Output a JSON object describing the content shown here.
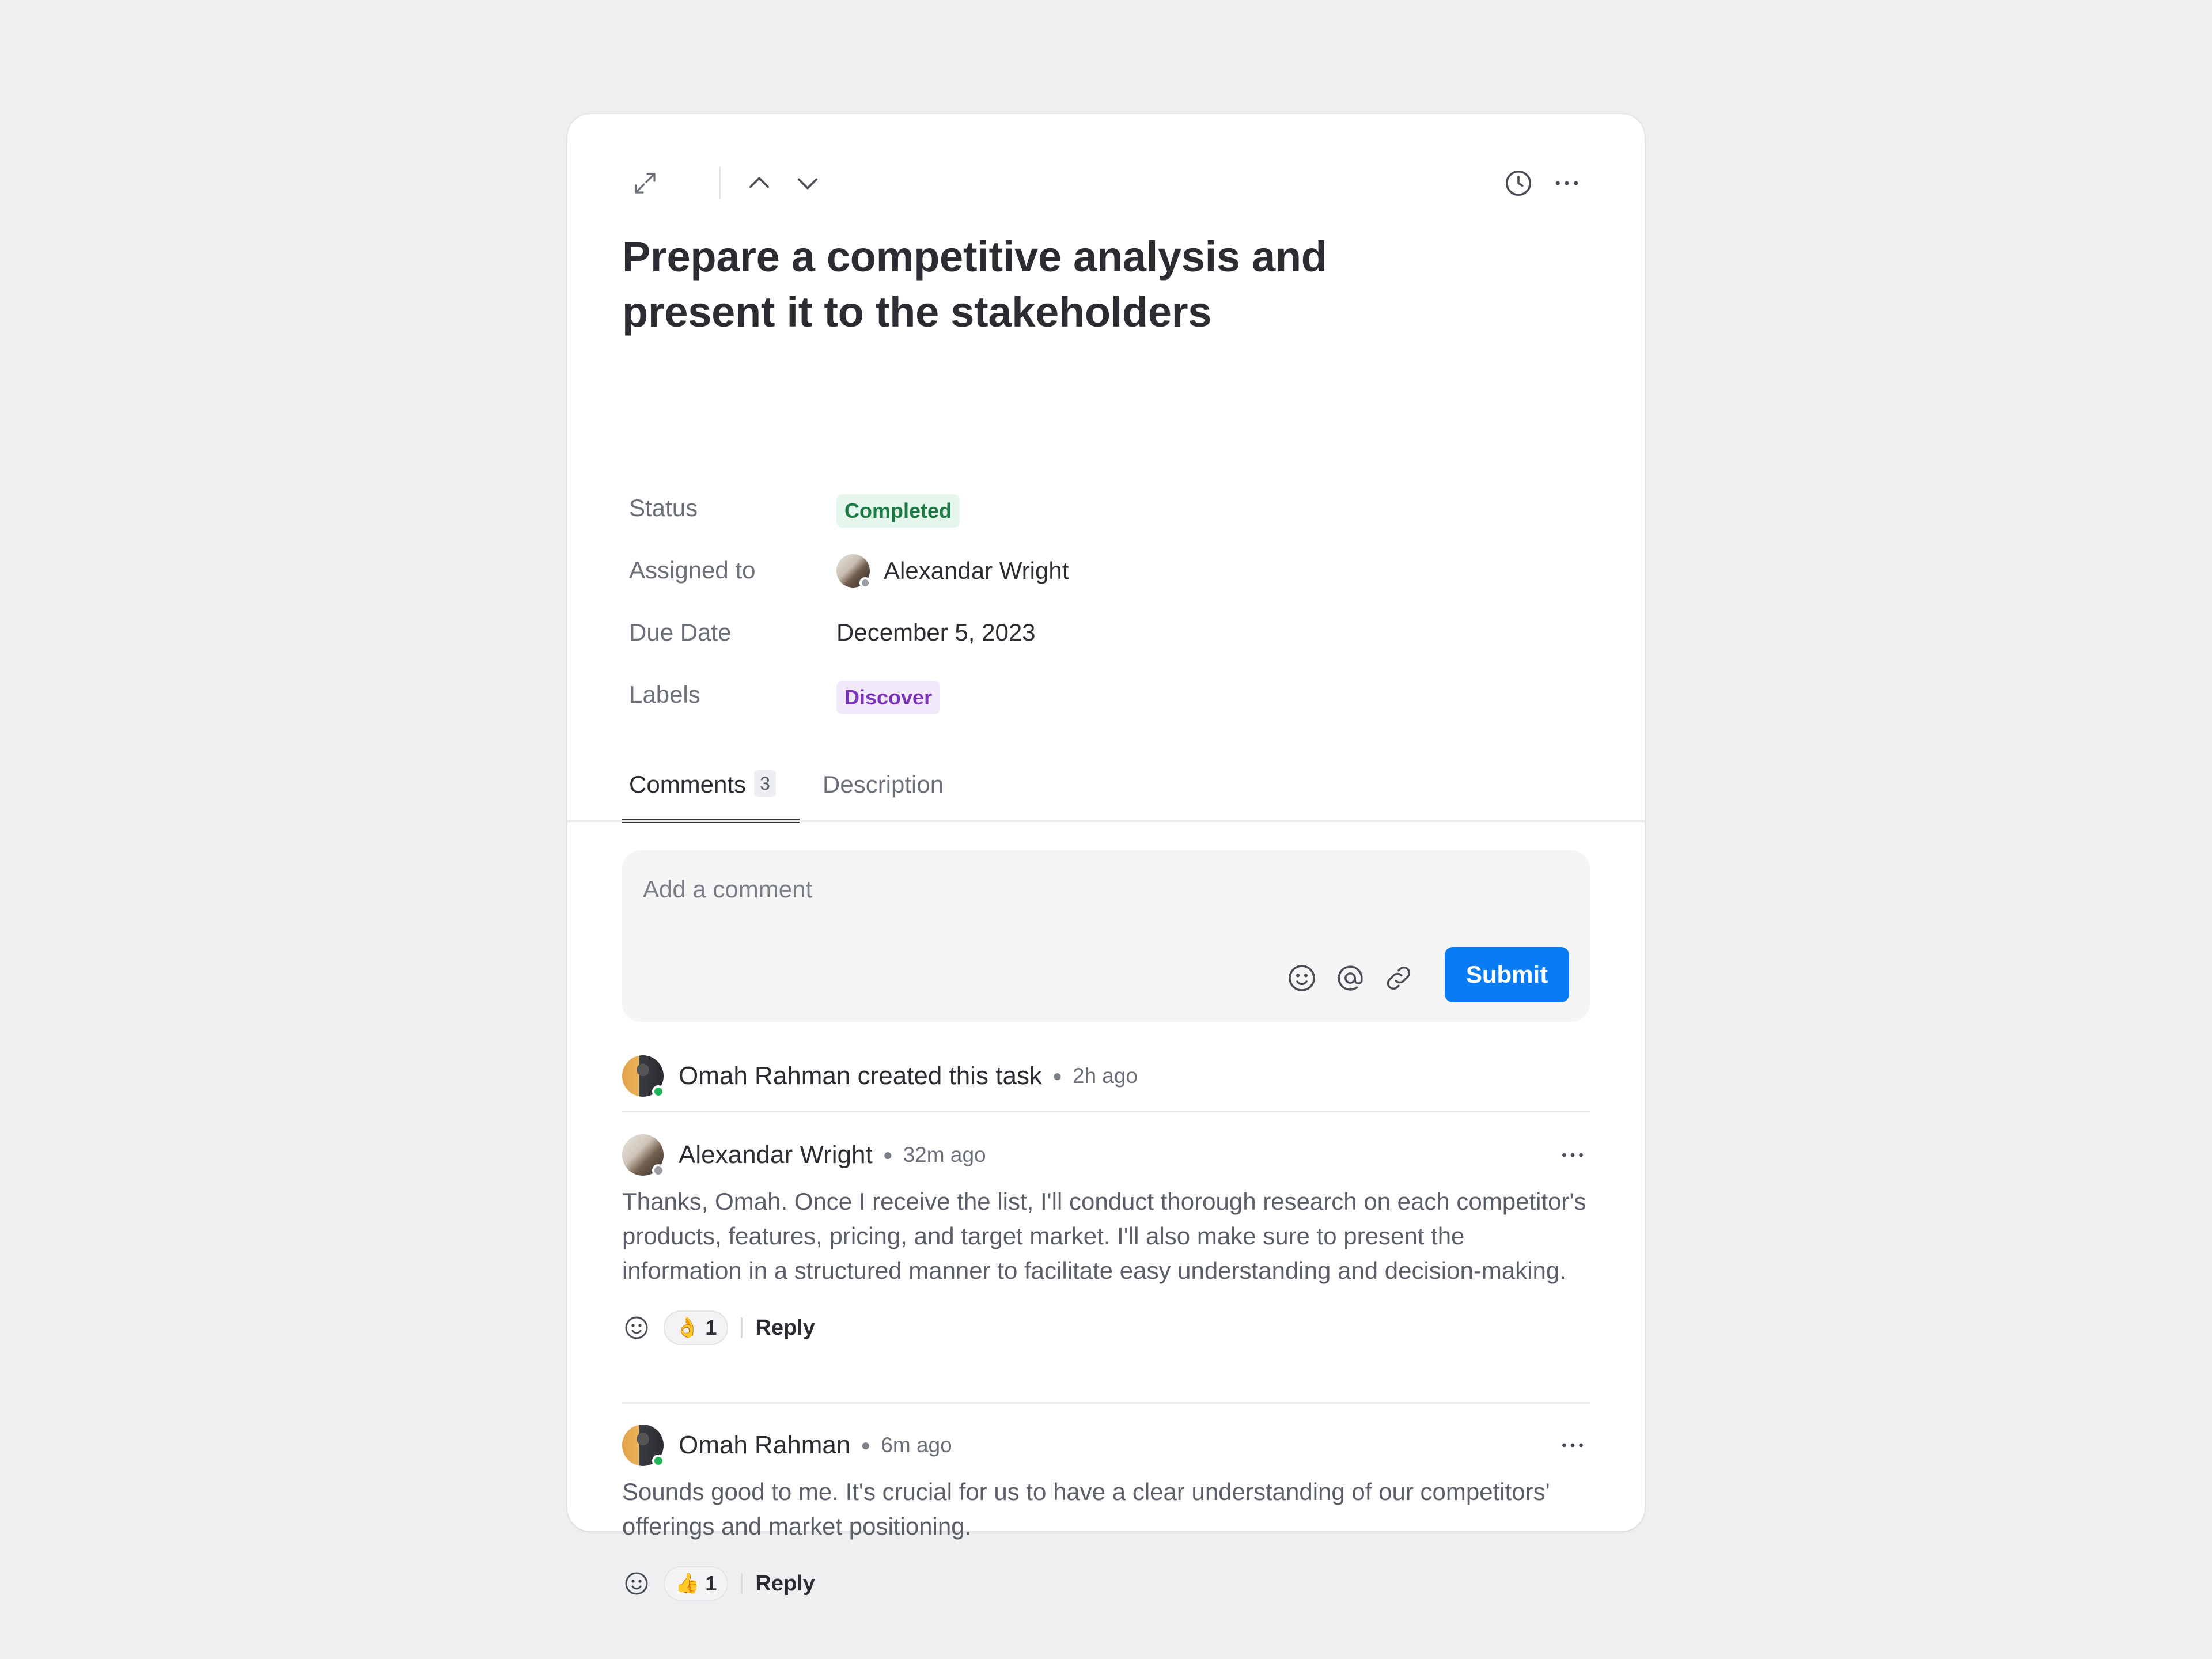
{
  "task": {
    "title": "Prepare a competitive analysis and present it to the stakeholders"
  },
  "toolbar": {
    "icons": [
      "expand-icon",
      "chevron-up-icon",
      "chevron-down-icon",
      "clock-icon",
      "more-icon"
    ]
  },
  "fields": {
    "status_label": "Status",
    "status_value": "Completed",
    "assigned_label": "Assigned to",
    "assigned_value": "Alexandar Wright",
    "due_label": "Due Date",
    "due_value": "December 5, 2023",
    "labels_label": "Labels",
    "labels_value": "Discover"
  },
  "tabs": {
    "comments_label": "Comments",
    "comments_count": "3",
    "description_label": "Description"
  },
  "composer": {
    "placeholder": "Add a comment",
    "submit_label": "Submit",
    "icons": [
      "emoji-icon",
      "mention-icon",
      "link-icon"
    ]
  },
  "activity": {
    "text": "Omah Rahman created this task",
    "time": "2h ago"
  },
  "comments": [
    {
      "author": "Alexandar Wright",
      "time": "32m ago",
      "body": "Thanks, Omah. Once I receive the list, I'll conduct thorough research on each competitor's products, features, pricing, and target market. I'll also make sure to present the information in a structured manner to facilitate easy understanding and decision-making.",
      "reaction_emoji": "👌",
      "reaction_count": "1",
      "reply_label": "Reply"
    },
    {
      "author": "Omah Rahman",
      "time": "6m ago",
      "body": "Sounds good to me. It's crucial for us to have a clear understanding of our competitors' offerings and market positioning.",
      "reaction_emoji": "👍",
      "reaction_count": "1",
      "reply_label": "Reply"
    }
  ],
  "colors": {
    "accent": "#0a7cf3",
    "status_bg": "#e5f7ec",
    "status_text": "#1e7a45",
    "label_bg": "#f2e9fb",
    "label_text": "#7a35b8",
    "online": "#22b35a",
    "offline": "#9a9ca3"
  }
}
